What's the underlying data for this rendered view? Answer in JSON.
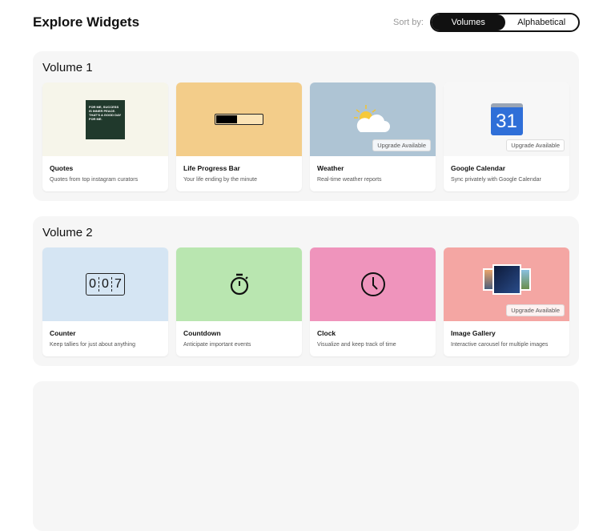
{
  "header": {
    "title": "Explore Widgets",
    "sort_label": "Sort by:",
    "sort_options": [
      "Volumes",
      "Alphabetical"
    ],
    "selected": "Volumes"
  },
  "volumes": [
    {
      "title": "Volume 1",
      "widgets": [
        {
          "name": "Quotes",
          "desc": "Quotes from top instagram curators",
          "bg": "#f6f5ea",
          "quote_text": "FOR ME, SUCCESS IS INNER PEACE. THAT'S A GOOD DAY FOR ME."
        },
        {
          "name": "Life Progress Bar",
          "desc": "Your life ending by the minute",
          "bg": "#f3cd8a",
          "progress": 0.45
        },
        {
          "name": "Weather",
          "desc": "Real-time weather reports",
          "bg": "#aec4d4",
          "badge": "Upgrade Available"
        },
        {
          "name": "Google Calendar",
          "desc": "Sync privately with Google Calendar",
          "bg": "#f7f7f7",
          "badge": "Upgrade Available",
          "cal_day": "31"
        }
      ]
    },
    {
      "title": "Volume 2",
      "widgets": [
        {
          "name": "Counter",
          "desc": "Keep tallies for just about anything",
          "bg": "#d5e5f3",
          "digits": [
            "0",
            "0",
            "7"
          ]
        },
        {
          "name": "Countdown",
          "desc": "Anticipate important events",
          "bg": "#b9e6b0"
        },
        {
          "name": "Clock",
          "desc": "Visualize and keep track of time",
          "bg": "#ef94bc"
        },
        {
          "name": "Image Gallery",
          "desc": "Interactive carousel for multiple images",
          "bg": "#f4a6a3",
          "badge": "Upgrade Available"
        }
      ]
    }
  ]
}
